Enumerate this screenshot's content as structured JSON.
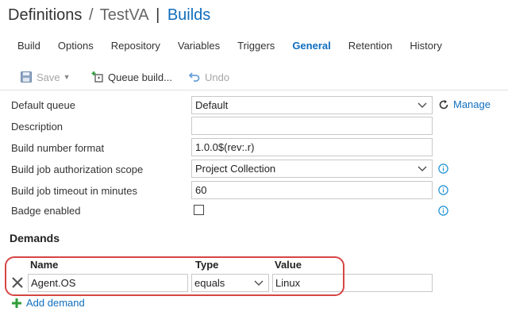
{
  "header": {
    "breadcrumb_definitions": "Definitions",
    "breadcrumb_separator": "/",
    "definition_name": "TestVA",
    "divider": "|",
    "current_page": "Builds"
  },
  "tabs": [
    {
      "label": "Build"
    },
    {
      "label": "Options"
    },
    {
      "label": "Repository"
    },
    {
      "label": "Variables"
    },
    {
      "label": "Triggers"
    },
    {
      "label": "General",
      "active": true
    },
    {
      "label": "Retention"
    },
    {
      "label": "History"
    }
  ],
  "toolbar": {
    "save_label": "Save",
    "save_icon": "save-icon",
    "queue_label": "Queue build...",
    "queue_icon": "queue-build-icon",
    "undo_label": "Undo",
    "undo_icon": "undo-icon"
  },
  "form": {
    "default_queue": {
      "label": "Default queue",
      "value": "Default",
      "manage_label": "Manage"
    },
    "description": {
      "label": "Description",
      "value": ""
    },
    "build_number_format": {
      "label": "Build number format",
      "value": "1.0.0$(rev:.r)"
    },
    "auth_scope": {
      "label": "Build job authorization scope",
      "value": "Project Collection"
    },
    "timeout": {
      "label": "Build job timeout in minutes",
      "value": "60"
    },
    "badge": {
      "label": "Badge enabled",
      "checked": false
    }
  },
  "demands": {
    "title": "Demands",
    "columns": {
      "name": "Name",
      "type": "Type",
      "value": "Value"
    },
    "rows": [
      {
        "name": "Agent.OS",
        "type": "equals",
        "value": "Linux"
      }
    ],
    "add_label": "Add demand"
  },
  "colors": {
    "accent": "#106ebe",
    "highlight": "#d64545",
    "info": "#1a8fd6",
    "add": "#2e9e3a"
  }
}
